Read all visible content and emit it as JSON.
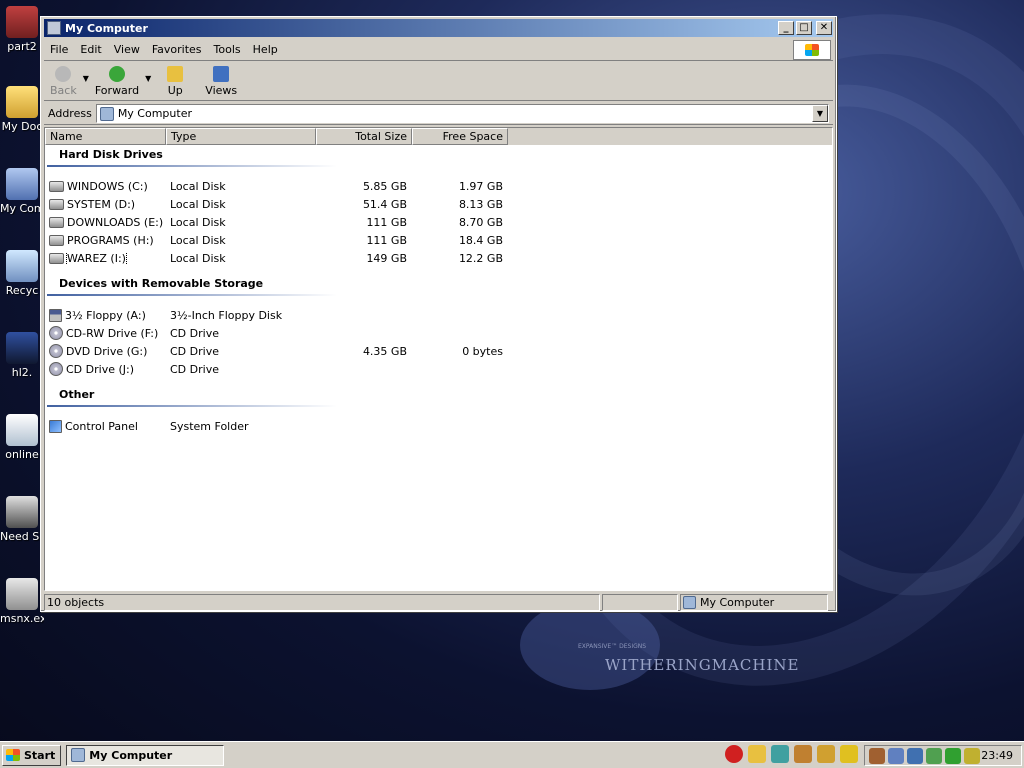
{
  "desktop": {
    "icons": [
      {
        "label": "part2"
      },
      {
        "label": "My Doc"
      },
      {
        "label": "My Com"
      },
      {
        "label": "Recyc"
      },
      {
        "label": "hl2."
      },
      {
        "label": "online"
      },
      {
        "label": "Need Speed"
      },
      {
        "label": "msnx.exe"
      }
    ],
    "brand_small": "EXPANSIVE™ DESIGNS",
    "brand_text": "WITHERINGMACHINE"
  },
  "window": {
    "title": "My Computer",
    "title_icon": "computer-icon",
    "menus": [
      {
        "label": "File"
      },
      {
        "label": "Edit"
      },
      {
        "label": "View"
      },
      {
        "label": "Favorites"
      },
      {
        "label": "Tools"
      },
      {
        "label": "Help"
      }
    ],
    "toolbar": {
      "back_label": "Back",
      "forward_label": "Forward",
      "up_label": "Up",
      "views_label": "Views"
    },
    "address": {
      "label": "Address",
      "value": "My Computer"
    },
    "columns": {
      "name": "Name",
      "type": "Type",
      "total": "Total Size",
      "free": "Free Space"
    },
    "groups": [
      {
        "title": "Hard Disk Drives",
        "rows": [
          {
            "name": "WINDOWS (C:)",
            "type": "Local Disk",
            "total": "5.85 GB",
            "free": "1.97 GB",
            "icon": "hard-drive-icon"
          },
          {
            "name": "SYSTEM (D:)",
            "type": "Local Disk",
            "total": "51.4 GB",
            "free": "8.13 GB",
            "icon": "hard-drive-icon"
          },
          {
            "name": "DOWNLOADS (E:)",
            "type": "Local Disk",
            "total": "111 GB",
            "free": "8.70 GB",
            "icon": "hard-drive-icon"
          },
          {
            "name": "PROGRAMS (H:)",
            "type": "Local Disk",
            "total": "111 GB",
            "free": "18.4 GB",
            "icon": "hard-drive-icon"
          },
          {
            "name": "WAREZ (I:)",
            "type": "Local Disk",
            "total": "149 GB",
            "free": "12.2 GB",
            "icon": "hard-drive-icon"
          }
        ]
      },
      {
        "title": "Devices with Removable Storage",
        "rows": [
          {
            "name": "3½ Floppy (A:)",
            "type": "3½-Inch Floppy Disk",
            "total": "",
            "free": "",
            "icon": "floppy-icon"
          },
          {
            "name": "CD-RW Drive (F:)",
            "type": "CD Drive",
            "total": "",
            "free": "",
            "icon": "cd-drive-icon"
          },
          {
            "name": "DVD Drive (G:)",
            "type": "CD Drive",
            "total": "4.35 GB",
            "free": "0 bytes",
            "icon": "cd-drive-icon"
          },
          {
            "name": "CD Drive (J:)",
            "type": "CD Drive",
            "total": "",
            "free": "",
            "icon": "cd-drive-icon"
          }
        ]
      },
      {
        "title": "Other",
        "rows": [
          {
            "name": "Control Panel",
            "type": "System Folder",
            "total": "",
            "free": "",
            "icon": "control-panel-icon"
          }
        ]
      }
    ],
    "status": {
      "objects": "10 objects",
      "zone": "My Computer"
    }
  },
  "taskbar": {
    "start_label": "Start",
    "task_label": "My Computer",
    "clock": "23:49"
  }
}
